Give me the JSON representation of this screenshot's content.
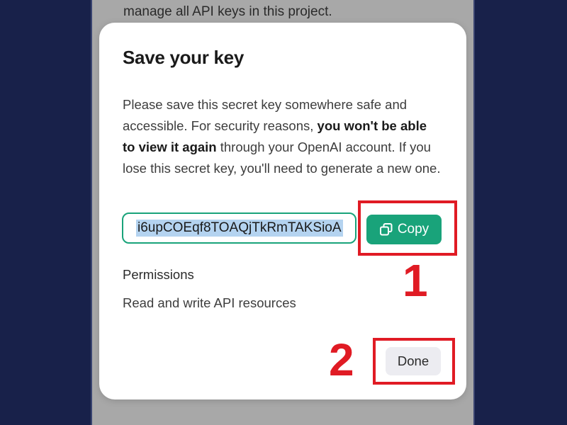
{
  "background": {
    "partial_text": "manage all API keys in this project."
  },
  "modal": {
    "title": "Save your key",
    "description": {
      "part1": "Please save this secret key somewhere safe and accessible. For security reasons, ",
      "bold1": "you won't be able to view it again",
      "part2": " through your OpenAI account. If you lose this secret key, you'll need to generate a new one."
    },
    "key_value": "i6upCOEqf8TOAQjTkRmTAKSioA",
    "copy_label": "Copy",
    "permissions_heading": "Permissions",
    "permissions_value": "Read and write API resources",
    "done_label": "Done"
  },
  "annotations": {
    "step1": "1",
    "step2": "2"
  },
  "colors": {
    "accent_green": "#19a37a",
    "annotation_red": "#e01b24",
    "page_background": "#18214a",
    "selection_highlight": "#b4d3f0"
  },
  "icons": {
    "copy": "copy-icon"
  }
}
